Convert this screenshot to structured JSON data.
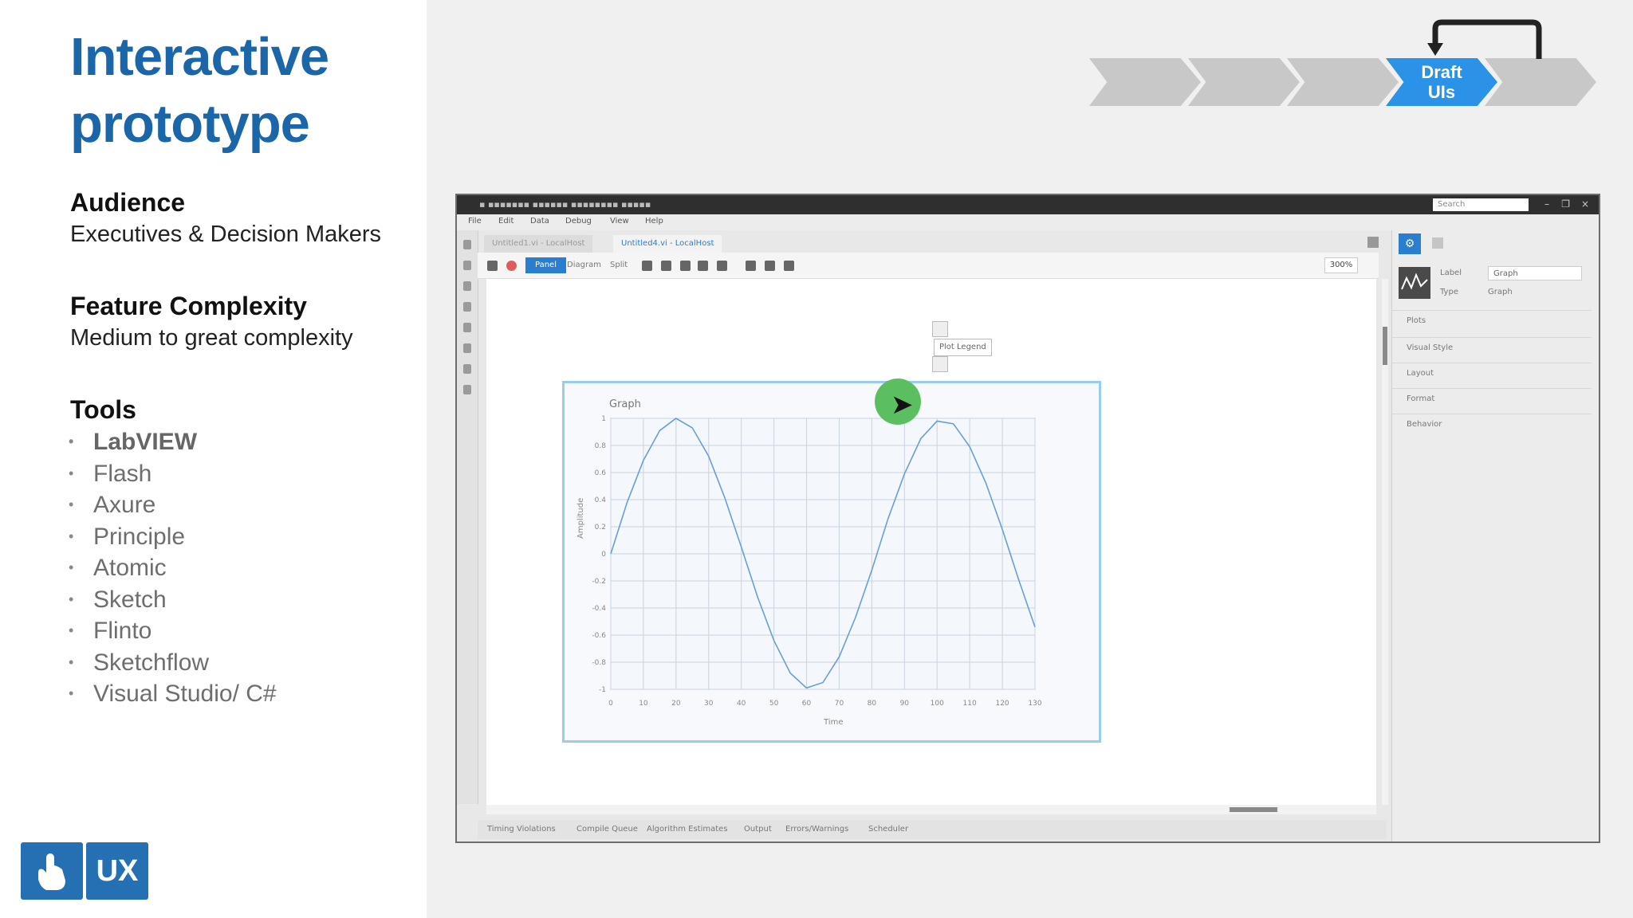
{
  "slide": {
    "title_line1": "Interactive",
    "title_line2": "prototype",
    "audience_heading": "Audience",
    "audience_text": "Executives & Decision Makers",
    "complexity_heading": "Feature Complexity",
    "complexity_text": "Medium to great complexity",
    "tools_heading": "Tools",
    "tools": [
      "LabVIEW",
      "Flash",
      "Axure",
      "Principle",
      "Atomic",
      "Sketch",
      "Flinto",
      "Sketchflow",
      "Visual Studio/ C#"
    ],
    "logo_text": "UX"
  },
  "process": {
    "active_label_line1": "Draft",
    "active_label_line2": "UIs",
    "colors": {
      "active": "#2a93e8",
      "inactive": "#c8c8c8"
    }
  },
  "app": {
    "search_placeholder": "Search",
    "menu": [
      "File",
      "Edit",
      "Data",
      "Debug",
      "View",
      "Help"
    ],
    "tabs": [
      "Untitled1.vi - LocalHost",
      "Untitled4.vi - LocalHost"
    ],
    "toolbar": {
      "panel": "Panel",
      "diagram": "Diagram",
      "split": "Split",
      "zoom": "300%"
    },
    "graph": {
      "title": "Graph",
      "xlabel": "Time",
      "ylabel": "Amplitude",
      "tooltip": "Plot Legend"
    },
    "status_tabs": [
      "Timing Violations",
      "Compile Queue",
      "Algorithm Estimates",
      "Output",
      "Errors/Warnings",
      "Scheduler"
    ],
    "properties": {
      "label_key": "Label",
      "label_value": "Graph",
      "type_key": "Type",
      "type_value": "Graph",
      "sections": [
        "Plots",
        "Visual Style",
        "Layout",
        "Format",
        "Behavior"
      ]
    }
  },
  "chart_data": {
    "type": "line",
    "title": "Graph",
    "xlabel": "Time",
    "ylabel": "Amplitude",
    "xlim": [
      0,
      130
    ],
    "ylim": [
      -1,
      1
    ],
    "x_ticks": [
      0,
      10,
      20,
      30,
      40,
      50,
      60,
      70,
      80,
      90,
      100,
      110,
      120,
      130
    ],
    "y_ticks": [
      -1,
      -0.8,
      -0.6,
      -0.4,
      -0.2,
      0,
      0.2,
      0.4,
      0.6,
      0.8,
      1
    ],
    "x": [
      0,
      5,
      10,
      15,
      20,
      25,
      30,
      35,
      40,
      45,
      50,
      55,
      60,
      65,
      70,
      75,
      80,
      85,
      90,
      95,
      100,
      105,
      110,
      115,
      120,
      125,
      130
    ],
    "values": [
      0,
      0.38,
      0.69,
      0.91,
      1.0,
      0.93,
      0.72,
      0.41,
      0.05,
      -0.32,
      -0.64,
      -0.88,
      -0.99,
      -0.95,
      -0.76,
      -0.47,
      -0.12,
      0.26,
      0.59,
      0.85,
      0.98,
      0.96,
      0.79,
      0.52,
      0.18,
      -0.19,
      -0.54
    ],
    "grid": true,
    "legend": "none"
  }
}
